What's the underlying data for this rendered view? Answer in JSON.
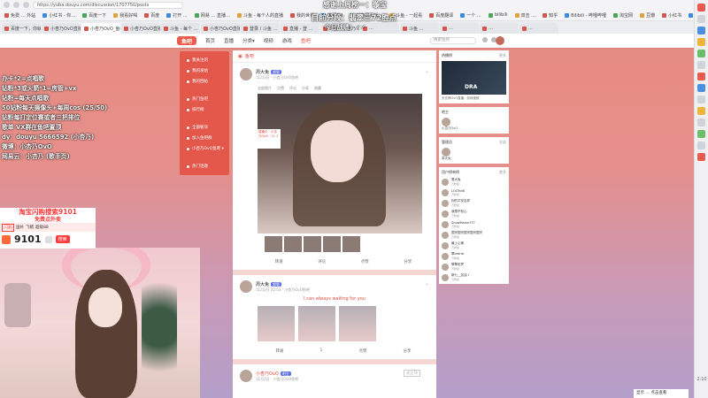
{
  "browser": {
    "url": "https://yuba.douyu.com/discussion/1707750/posts",
    "bookmarks": [
      "免费 … 外站",
      "小红书 - 你…",
      "百度一下",
      "我看好喝",
      "百度",
      "打开 …",
      "网易 … 直播…",
      "斗鱼 - 每个人的直播",
      "我的世界",
      "猫耳FM",
      "抖音网页版…",
      "斗鱼 - 一起看",
      "百度翻译",
      "一个 …",
      "bilibili",
      "双击 …",
      "知乎",
      "Bilibili - 哔哩哔哩",
      "淘宝网",
      "豆瓣",
      "小红书",
      "百度地图",
      "…",
      "…",
      "…",
      "其他书签"
    ],
    "tabs": [
      "百度一下，你就知道",
      "小杏乃OvO直播 - 我的 …",
      "小杏乃OvO_鱼吧",
      "小杏乃OvO直播 - 我的 …",
      "斗鱼 - 每个 …",
      "小杏乃OvO直播 …",
      "登录 / 斗鱼 …",
      "直播 - 登 …",
      "斗鱼 - 小杏乃 OvO …",
      "…",
      "斗鱼 …",
      "…",
      "…",
      "…"
    ],
    "clock": "2:10"
  },
  "overlay": {
    "top_line1": "感谢上周榜一：璇宝",
    "top_line2": "目前分段：翡翠三72胜点",
    "top_line3": "今日战绩：✓✓",
    "left_lines": [
      "办卡*2=点唱歌",
      "钻粉*3或火箭*1=房管+vx",
      "钻粉=每天点唱歌",
      "50钻粉每天摄像头+每周cos (25/50)",
      "钻粉每打定位赛或者三把排位",
      "歌单 VX群在鱼吧置顶",
      "dy：douyu 5666592 (小杏乃)",
      "微博：小杏乃OvO",
      "网易云：小杏乃 (歌手页)"
    ]
  },
  "ad": {
    "title": "淘宝闪购搜索9101",
    "subtitle": "免费点外卖",
    "row_tags": [
      "闪购",
      "国补",
      "飞猪",
      "超级88"
    ],
    "number": "9101",
    "button": "搜索"
  },
  "site": {
    "logo": "鱼吧",
    "nav": [
      "首页",
      "直播",
      "分类▾",
      "视频",
      "游戏",
      "鱼吧"
    ],
    "search_placeholder": "搜索鱼吧"
  },
  "left_menu": [
    "我关注的",
    "我的发帖",
    "我的回帖",
    "热门鱼吧",
    "排行榜",
    "全部板块",
    "加入鱼吧群",
    "小杏乃OvO鱼吧 ▾",
    "热门话题"
  ],
  "feed": {
    "header": "鱼吧",
    "posts": [
      {
        "author": "周大兔",
        "badge": "超管",
        "meta": "11月3日 · 小杏乃OvO鱼吧",
        "toolbar": [
          "全部图片",
          "点赞",
          "评论",
          "分享",
          "收藏"
        ],
        "sign": "直播中 · 小杏乃OvO · 11.1",
        "actions": [
          "转发",
          "评论",
          "点赞",
          "分享"
        ]
      },
      {
        "author": "周大兔",
        "badge": "超管",
        "meta": "11月2日 22:53 · 小杏乃OvO鱼吧",
        "text": "I can always waiting for you",
        "actions": [
          "转发",
          "1",
          "点赞",
          "分享"
        ]
      },
      {
        "author": "小杏乃OvO",
        "badge": "吧主",
        "meta": "11月2日 · 小杏乃OvO鱼吧",
        "follow": "关注TA"
      }
    ]
  },
  "right": {
    "ad_title": "热播榜",
    "ad_more": "更多",
    "video_text": "DRA",
    "video_caption": "天玄神OvO直播 · 游戏视频",
    "owner_title": "吧主",
    "owner_name": "小杏乃OvO",
    "mgr_title": "管理员",
    "mgr_more": "全部",
    "mgr_name": "周大兔",
    "fans_title": "用户榜单榜",
    "fans_more": "更多",
    "fans": [
      {
        "name": "周大兔",
        "sub": "万粉级"
      },
      {
        "name": "LOLTheB",
        "sub": "万粉级"
      },
      {
        "name": "你的平安吉祥",
        "sub": "万粉级"
      },
      {
        "name": "我想不知心",
        "sub": "万粉级"
      },
      {
        "name": "SnowMarke777",
        "sub": "万粉级"
      },
      {
        "name": "国宗国宗国宗国宗国宗",
        "sub": "万粉级"
      },
      {
        "name": "最上心情",
        "sub": "万粉级"
      },
      {
        "name": "翠drdrdr",
        "sub": "万粉级"
      },
      {
        "name": "翠翠彩梦",
        "sub": "万粉级"
      },
      {
        "name": "新七__加油 ♪",
        "sub": "万粉级"
      }
    ]
  },
  "floating_bar": "显示 … 点击查看"
}
